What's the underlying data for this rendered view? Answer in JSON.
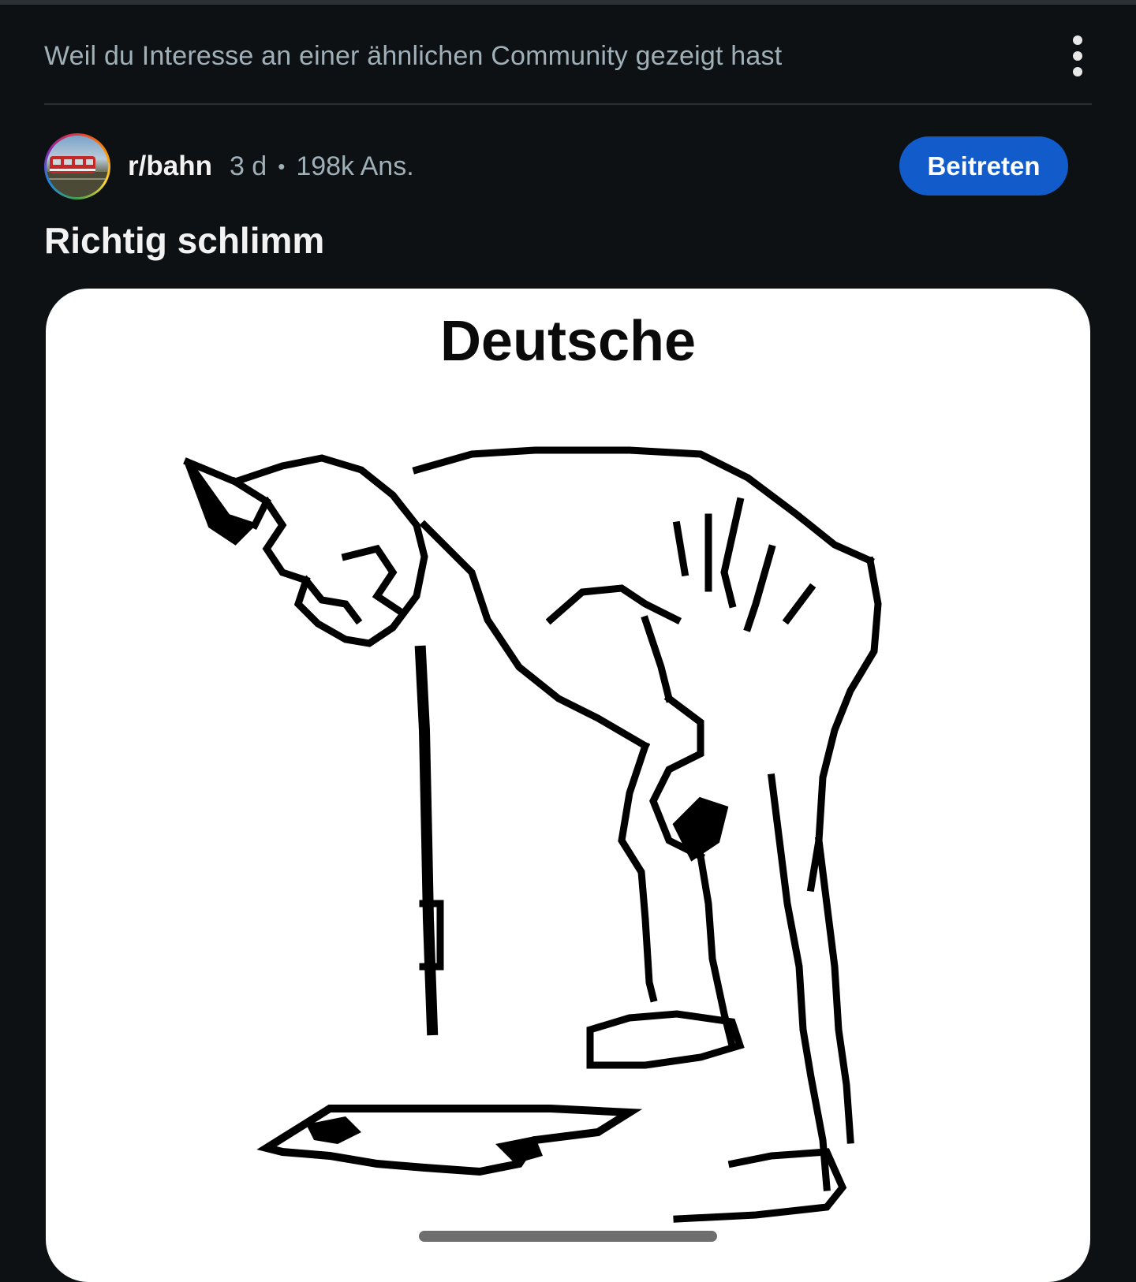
{
  "feed_reason": {
    "text": "Weil du Interesse an einer ähnlichen Community gezeigt hast",
    "menu_icon": "more-vertical-icon"
  },
  "post": {
    "subreddit": "r/bahn",
    "age": "3 d",
    "separator": "•",
    "views": "198k Ans.",
    "join_label": "Beitreten",
    "title": "Richtig schlimm",
    "image": {
      "caption": "Deutsche"
    }
  },
  "colors": {
    "background": "#0e1113",
    "join_button": "#115bca",
    "secondary_text": "#9fb0b8"
  }
}
